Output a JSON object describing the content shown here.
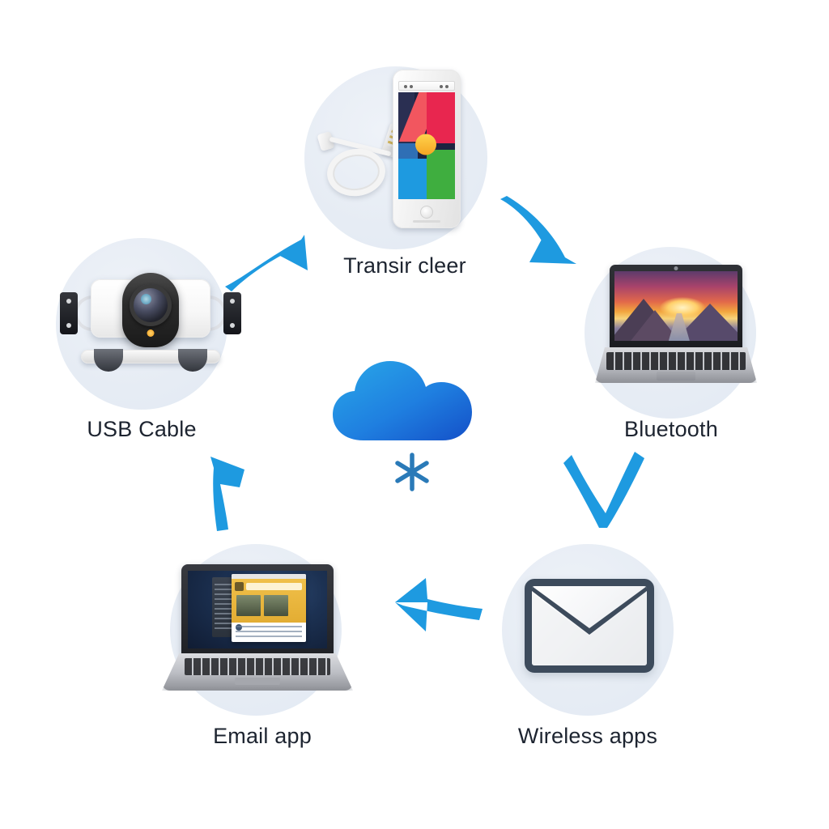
{
  "diagram": {
    "title": "File transfer methods cycle diagram",
    "layout": "radial-cycle",
    "background_color": "#ffffff",
    "accent_color": "#1e9ae0",
    "node_disc_color": "#e6ecf4",
    "label_color": "#1d2430",
    "center": {
      "icon": "cloud-icon",
      "secondary_icon": "asterisk-snowflake-icon",
      "cloud_gradient_start": "#29a8e8",
      "cloud_gradient_end": "#1450c8",
      "asterisk_color": "#2a7ab8"
    },
    "nodes": [
      {
        "id": "transir-cleer",
        "label": "Transir cleer",
        "position": "top",
        "icon": "smartphone-and-usb-cable-icon",
        "description": "White smartphone with colorful abstract wallpaper next to a coiled white USB cable"
      },
      {
        "id": "bluetooth",
        "label": "Bluetooth",
        "position": "right",
        "icon": "laptop-sunset-wallpaper-icon",
        "description": "Silver laptop displaying a sunset landscape wallpaper"
      },
      {
        "id": "wireless-apps",
        "label": "Wireless apps",
        "position": "bottom-right",
        "icon": "envelope-icon",
        "description": "Dark outlined envelope with white fill"
      },
      {
        "id": "email-app",
        "label": "Email app",
        "position": "bottom-left",
        "icon": "laptop-email-client-icon",
        "description": "Silver laptop showing an open email client window on a dark blue desktop"
      },
      {
        "id": "usb-cable",
        "label": "USB Cable",
        "position": "left",
        "icon": "webcam-camera-icon",
        "description": "White action camera or webcam with a dark lens and mounting brackets"
      }
    ],
    "arrows": [
      {
        "id": "arrow-email-to-usb",
        "from": "email-app",
        "to": "usb-cable",
        "direction": "up",
        "color": "#1e9ae0"
      },
      {
        "id": "arrow-usb-to-transir",
        "from": "usb-cable",
        "to": "transir-cleer",
        "direction": "up-right",
        "color": "#1e9ae0"
      },
      {
        "id": "arrow-transir-to-bt",
        "from": "transir-cleer",
        "to": "bluetooth",
        "direction": "down-right",
        "color": "#1e9ae0"
      },
      {
        "id": "arrow-bt-to-wireless",
        "from": "bluetooth",
        "to": "wireless-apps",
        "direction": "down",
        "color": "#1e9ae0"
      },
      {
        "id": "arrow-wireless-to-email",
        "from": "wireless-apps",
        "to": "email-app",
        "direction": "left",
        "color": "#1e9ae0"
      }
    ]
  }
}
